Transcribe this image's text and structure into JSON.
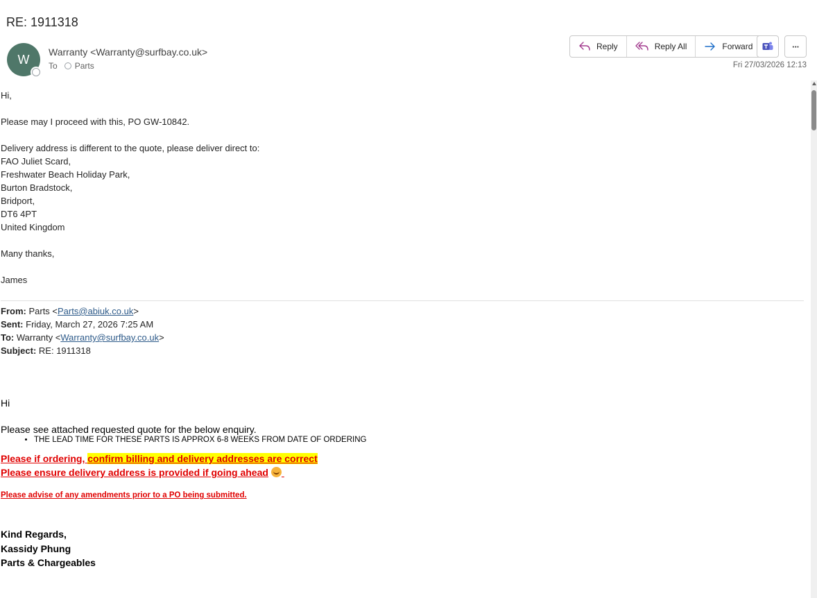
{
  "message": {
    "subject": "RE: 1911318",
    "sender_initial": "W",
    "sender": "Warranty <Warranty@surfbay.co.uk>",
    "to_label": "To",
    "to_recipient": "Parts",
    "datetime": "Fri 27/03/2026 12:13"
  },
  "actions": {
    "reply": "Reply",
    "reply_all": "Reply All",
    "forward": "Forward",
    "more": "···"
  },
  "body": {
    "greeting": "Hi,",
    "line1": "Please may I proceed with this, PO GW-10842.",
    "line2": "Delivery address is different to the quote, please deliver direct to:",
    "address": [
      "FAO Juliet Scard,",
      "Freshwater Beach Holiday Park,",
      "Burton Bradstock,",
      "Bridport,",
      "DT6 4PT",
      "United Kingdom"
    ],
    "thanks": "Many thanks,",
    "signoff": "James"
  },
  "quoted_header": {
    "from_label": "From:",
    "from_name": "Parts <",
    "from_email": "Parts@abiuk.co.uk",
    "from_close": ">",
    "sent_label": "Sent:",
    "sent_value": "Friday, March 27, 2026 7:25 AM",
    "to_label": "To:",
    "to_name": "Warranty <",
    "to_email": "Warranty@surfbay.co.uk",
    "to_close": ">",
    "subject_label": "Subject:",
    "subject_value": "RE: 1911318"
  },
  "quoted_body": {
    "greeting": "Hi",
    "line1": "Please see attached requested quote for the below enquiry.",
    "bullet": "THE LEAD TIME FOR THESE PARTS IS APPROX 6-8 WEEKS FROM DATE OF ORDERING",
    "red1_a": "Please if ordering, ",
    "red1_b": "confirm billing and delivery addresses are correct",
    "red2": "Please ensure delivery address is provided if going ahead",
    "red3": "Please advise of any amendments prior to a PO being submitted.",
    "sig1": "Kind Regards,",
    "sig2": "Kassidy Phung",
    "sig3": "Parts & Chargeables"
  },
  "colors": {
    "avatar": "#4f7769",
    "warning_red": "#e00000",
    "highlight": "#ffff00",
    "link": "#2d5a89",
    "reply_icon": "#a33d8f",
    "forward_icon": "#1e6fc9"
  }
}
